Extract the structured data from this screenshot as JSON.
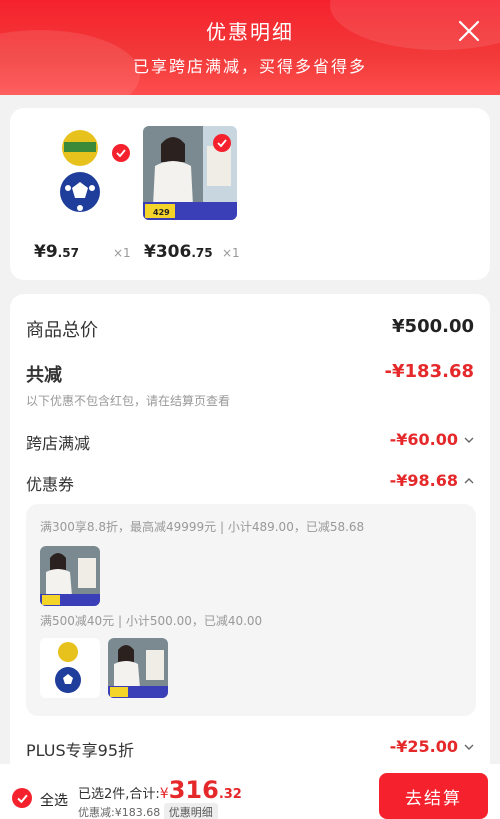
{
  "header": {
    "title": "优惠明细",
    "subtitle": "已享跨店满减，买得多省得多"
  },
  "products": [
    {
      "price_int": "¥9",
      "price_dec": ".57",
      "qty": "×1"
    },
    {
      "price_int": "¥306",
      "price_dec": ".75",
      "qty": "×1",
      "img_badge": "429"
    }
  ],
  "summary": {
    "total_label": "商品总价",
    "total_value": "¥500.00",
    "saved_label": "共减",
    "saved_value": "-¥183.68",
    "note": "以下优惠不包含红包，请在结算页查看",
    "items": [
      {
        "label": "跨店满减",
        "value": "-¥60.00"
      },
      {
        "label": "优惠券",
        "value": "-¥98.68"
      },
      {
        "label": "PLUS专享95折",
        "value": "-¥25.00"
      }
    ]
  },
  "coupons": [
    {
      "desc": "满300享8.8折，最高减49999元 | 小计489.00，已减58.68"
    },
    {
      "desc": "满500减40元 | 小计500.00，已减40.00"
    }
  ],
  "bottom": {
    "select_all": "全选",
    "selected_text": "已选2件,合计:",
    "currency": "¥",
    "total_int": "316",
    "total_dec": ".32",
    "saved_text": "优惠减:¥183.68",
    "detail_tag": "优惠明细",
    "checkout": "去结算"
  },
  "colors": {
    "accent": "#f5222d",
    "price_red": "#e5282a"
  }
}
